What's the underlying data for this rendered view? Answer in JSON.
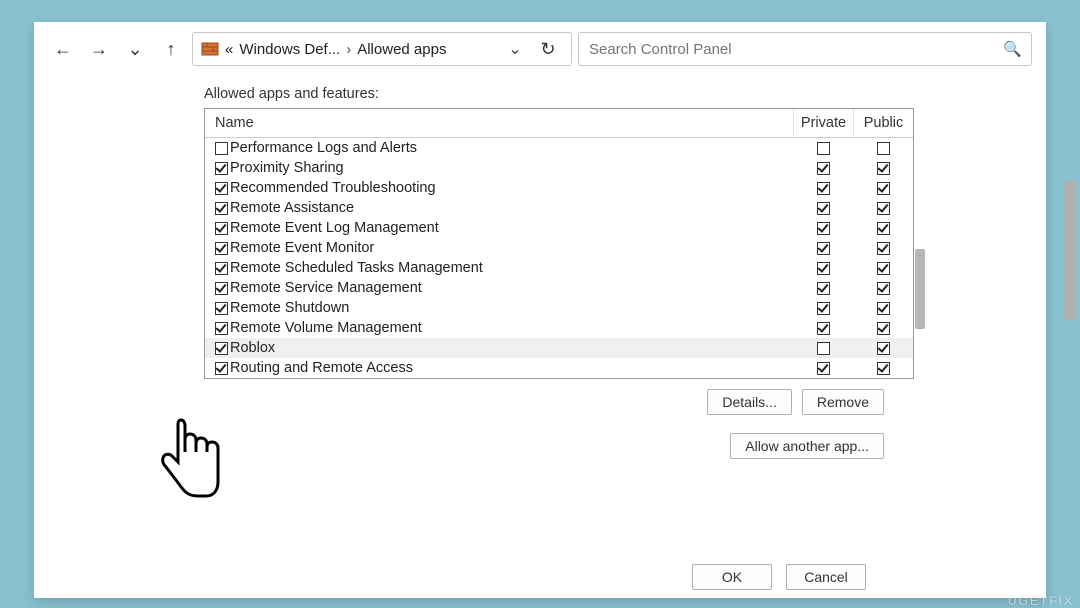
{
  "toolbar": {
    "breadcrumb": {
      "prefix": "«",
      "seg1": "Windows Def...",
      "seg2": "Allowed apps"
    },
    "search_placeholder": "Search Control Panel"
  },
  "panel": {
    "title": "Allowed apps and features:",
    "columns": {
      "name": "Name",
      "private": "Private",
      "public": "Public"
    },
    "rows": [
      {
        "name": "Performance Logs and Alerts",
        "enabled": false,
        "private": false,
        "public": false,
        "hl": false
      },
      {
        "name": "Proximity Sharing",
        "enabled": true,
        "private": true,
        "public": true,
        "hl": false
      },
      {
        "name": "Recommended Troubleshooting",
        "enabled": true,
        "private": true,
        "public": true,
        "hl": false
      },
      {
        "name": "Remote Assistance",
        "enabled": true,
        "private": true,
        "public": true,
        "hl": false
      },
      {
        "name": "Remote Event Log Management",
        "enabled": true,
        "private": true,
        "public": true,
        "hl": false
      },
      {
        "name": "Remote Event Monitor",
        "enabled": true,
        "private": true,
        "public": true,
        "hl": false
      },
      {
        "name": "Remote Scheduled Tasks Management",
        "enabled": true,
        "private": true,
        "public": true,
        "hl": false
      },
      {
        "name": "Remote Service Management",
        "enabled": true,
        "private": true,
        "public": true,
        "hl": false
      },
      {
        "name": "Remote Shutdown",
        "enabled": true,
        "private": true,
        "public": true,
        "hl": false
      },
      {
        "name": "Remote Volume Management",
        "enabled": true,
        "private": true,
        "public": true,
        "hl": false
      },
      {
        "name": "Roblox",
        "enabled": true,
        "private": false,
        "public": true,
        "hl": true
      },
      {
        "name": "Routing and Remote Access",
        "enabled": true,
        "private": true,
        "public": true,
        "hl": false
      }
    ],
    "details": "Details...",
    "remove": "Remove",
    "allow_another": "Allow another app..."
  },
  "footer": {
    "ok": "OK",
    "cancel": "Cancel"
  },
  "watermark": "UGETFIX"
}
